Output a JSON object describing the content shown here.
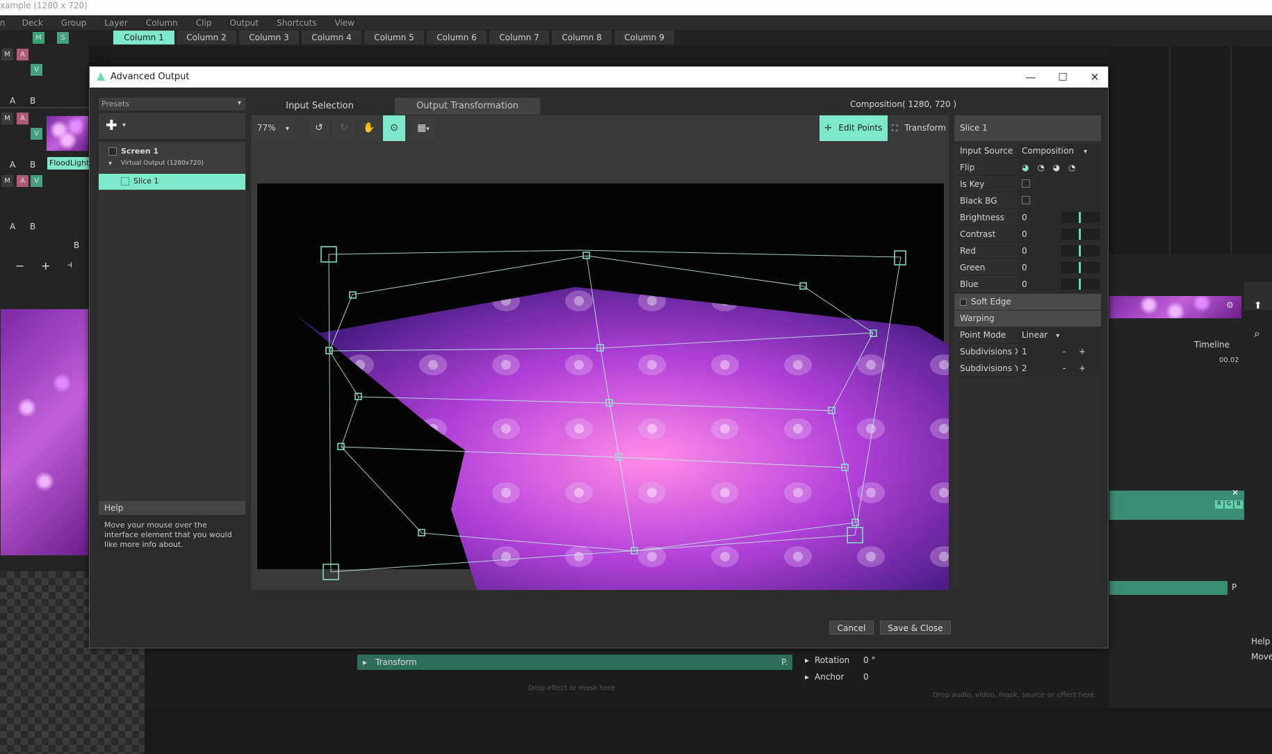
{
  "window": {
    "title_fragment": "xample (1280 x 720)"
  },
  "menu": [
    "n",
    "Deck",
    "Group",
    "Layer",
    "Column",
    "Clip",
    "Output",
    "Shortcuts",
    "View"
  ],
  "columns": [
    "Column 1",
    "Column 2",
    "Column 3",
    "Column 4",
    "Column 5",
    "Column 6",
    "Column 7",
    "Column 8",
    "Column 9"
  ],
  "layer_controls": {
    "m": "M",
    "s": "S",
    "a": "A",
    "v": "V",
    "b": "B",
    "minus": "−",
    "plus": "+",
    "bar": "⫞"
  },
  "floodlight_label": "FloodLight",
  "dialog": {
    "title": "Advanced Output",
    "presets_label": "Presets",
    "tabs": {
      "input": "Input Selection",
      "output": "Output Transformation"
    },
    "composition": "Composition( 1280, 720 )",
    "zoom": "77%",
    "edit_points": "Edit Points",
    "transform": "Transform",
    "tree": {
      "screen": "Screen 1",
      "virtual": "Virtual Output (1280x720)",
      "slice": "Slice 1"
    },
    "help_title": "Help",
    "help_text": "Move your mouse over the interface element that you would like more info about.",
    "cancel": "Cancel",
    "save_close": "Save & Close"
  },
  "properties": {
    "header": "Slice 1",
    "input_source": {
      "label": "Input Source",
      "value": "Composition"
    },
    "flip": {
      "label": "Flip"
    },
    "is_key": {
      "label": "Is Key"
    },
    "black_bg": {
      "label": "Black BG"
    },
    "brightness": {
      "label": "Brightness",
      "value": "0"
    },
    "contrast": {
      "label": "Contrast",
      "value": "0"
    },
    "red": {
      "label": "Red",
      "value": "0"
    },
    "green": {
      "label": "Green",
      "value": "0"
    },
    "blue": {
      "label": "Blue",
      "value": "0"
    },
    "soft_edge": "Soft Edge",
    "warping": "Warping",
    "point_mode": {
      "label": "Point Mode",
      "value": "Linear"
    },
    "subdiv_x": {
      "label": "Subdivisions X",
      "value": "1"
    },
    "subdiv_y": {
      "label": "Subdivisions Y",
      "value": "2"
    },
    "minus": "-",
    "plus": "+"
  },
  "right_panel": {
    "timeline": "Timeline",
    "time": "00.02",
    "rgb": [
      "R",
      "G",
      "B"
    ],
    "help": "Help",
    "move": "Move",
    "p": "P"
  },
  "bottom": {
    "transform": "Transform",
    "rotation": {
      "label": "Rotation",
      "value": "0 °"
    },
    "anchor": {
      "label": "Anchor",
      "value": "0"
    },
    "drop_effect": "Drop effect or mask here.",
    "drop_audio": "Drop audio, video, mask, source or effect here.",
    "p": "P."
  }
}
